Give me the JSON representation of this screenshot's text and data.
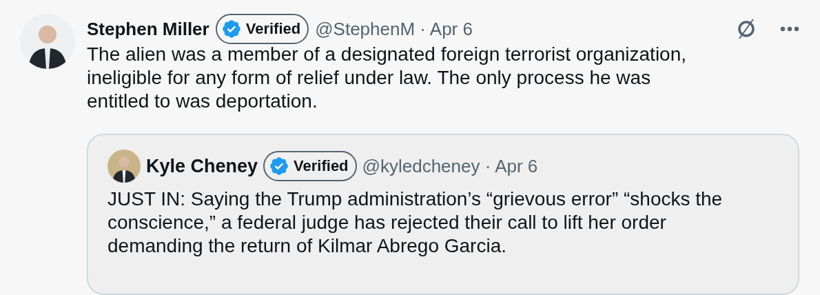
{
  "post": {
    "author": {
      "name": "Stephen Miller",
      "badge": "Verified",
      "handle": "@StephenM",
      "date": "· Apr 6"
    },
    "text": "The alien was a member of a designated foreign terrorist organization, ineligible for any form of relief under law. The only process he was entitled to was deportation.",
    "quote": {
      "author": {
        "name": "Kyle Cheney",
        "badge": "Verified",
        "handle": "@kyledcheney",
        "date": "· Apr 6"
      },
      "text": "JUST IN: Saying the Trump administration’s “grievous error” “shocks the conscience,” a federal judge has rejected their call to lift her order demanding the return of Kilmar Abrego Garcia."
    }
  }
}
